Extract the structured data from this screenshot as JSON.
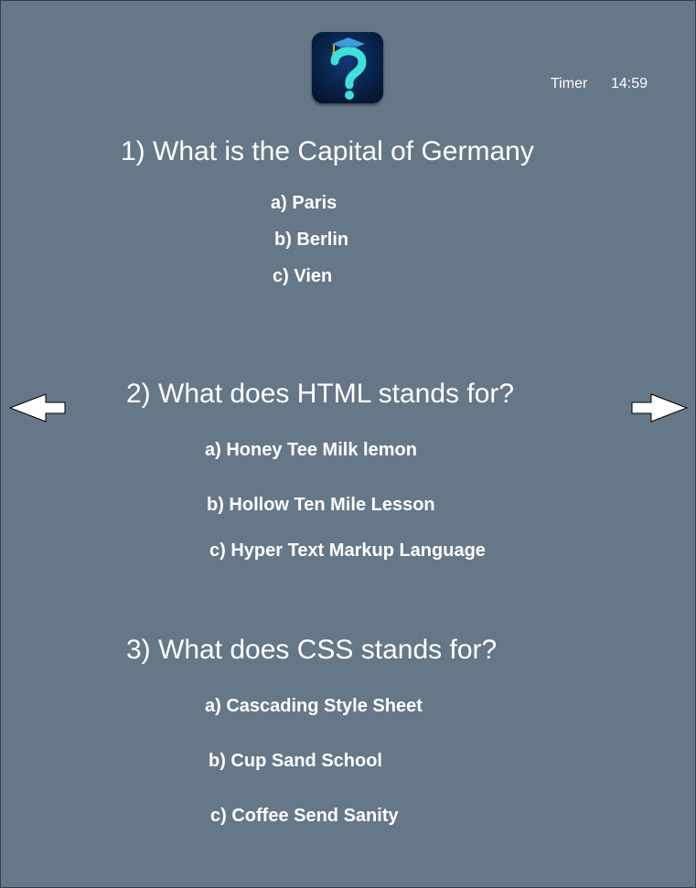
{
  "app": {
    "logo_icon": "question-mark-graduation-cap-icon",
    "background_color": "#667788",
    "accent_color": "#3ee0d8"
  },
  "timer": {
    "label": "Timer",
    "value": "14:59"
  },
  "navigation": {
    "prev_icon": "arrow-left-icon",
    "next_icon": "arrow-right-icon"
  },
  "questions": [
    {
      "text": "1) What is the Capital of Germany",
      "options": [
        "a) Paris",
        "b) Berlin",
        "c) Vien"
      ]
    },
    {
      "text": "2) What does HTML stands for?",
      "options": [
        "a)  Honey Tee Milk lemon",
        "b) Hollow Ten Mile Lesson",
        "c) Hyper Text Markup Language"
      ]
    },
    {
      "text": "3) What does CSS stands for?",
      "options": [
        "a)  Cascading Style Sheet",
        "b)  Cup Sand School",
        "c)  Coffee Send Sanity"
      ]
    }
  ]
}
